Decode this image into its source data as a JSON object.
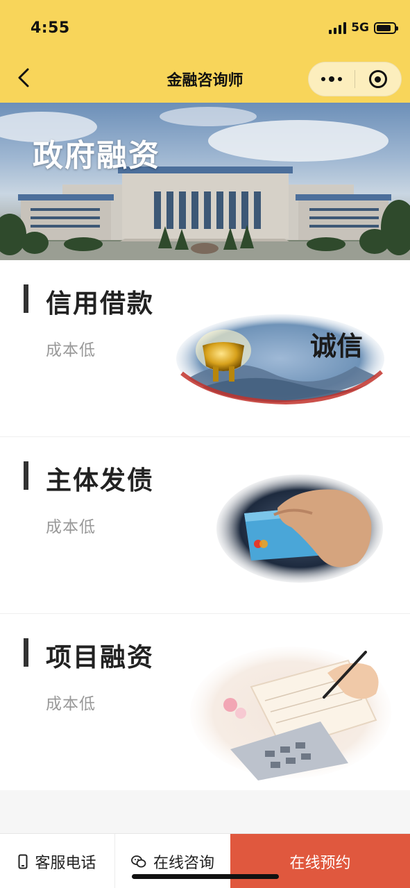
{
  "status_bar": {
    "time": "4:55",
    "network": "5G"
  },
  "nav": {
    "title": "金融咨询师"
  },
  "banner": {
    "title": "政府融资"
  },
  "cards": [
    {
      "title": "信用借款",
      "subtitle": "成本低",
      "image_text": "诚信"
    },
    {
      "title": "主体发债",
      "subtitle": "成本低"
    },
    {
      "title": "项目融资",
      "subtitle": "成本低"
    }
  ],
  "bottom_bar": {
    "phone_label": "客服电话",
    "chat_label": "在线咨询",
    "book_label": "在线预约"
  },
  "colors": {
    "header": "#f8d55a",
    "book_button": "#e0583e",
    "accent_bar": "#333333"
  },
  "icons": [
    "back-arrow-icon",
    "more-dots-icon",
    "close-target-icon",
    "phone-icon",
    "chat-icon",
    "signal-icon",
    "battery-icon"
  ]
}
